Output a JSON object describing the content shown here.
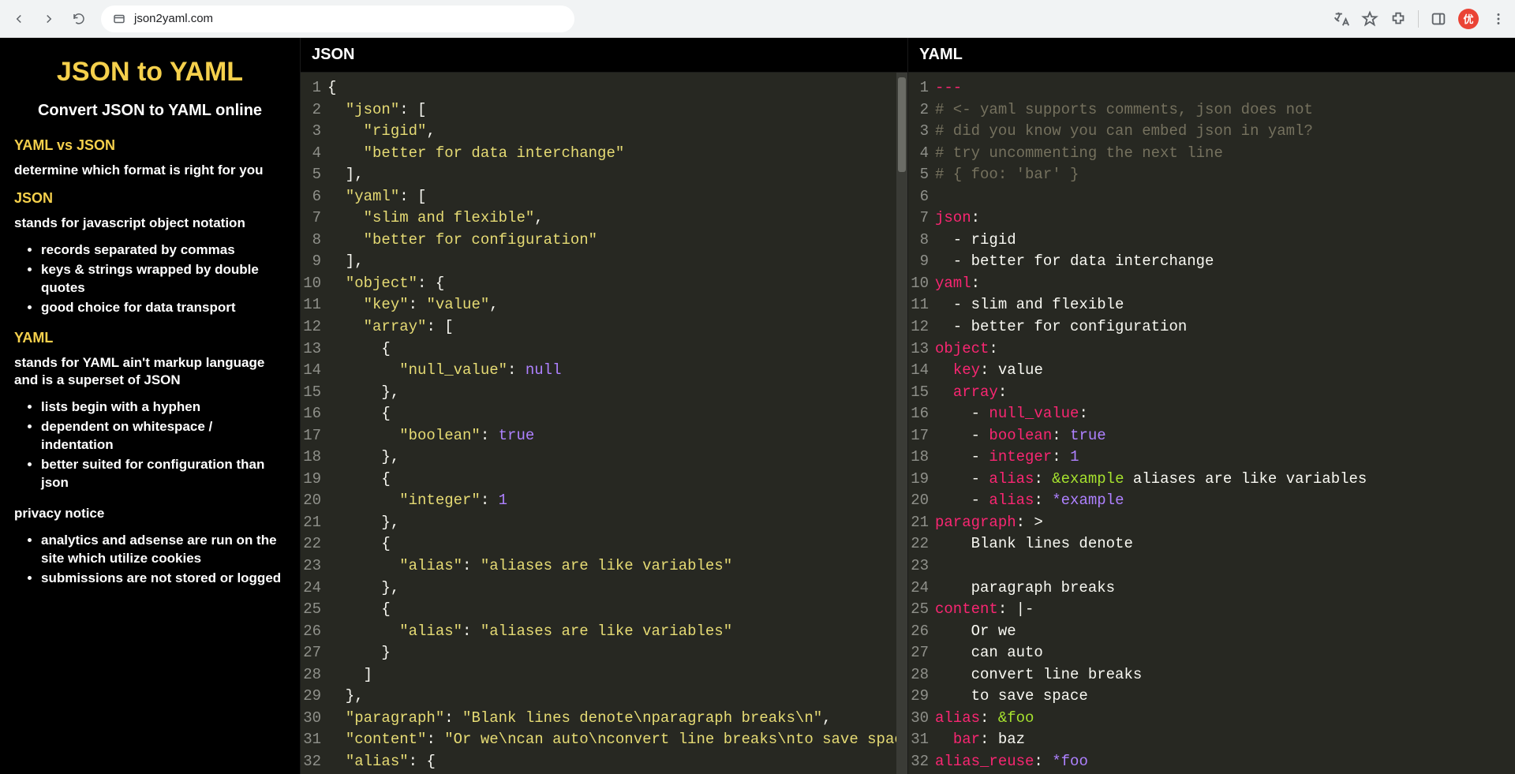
{
  "chrome": {
    "url": "json2yaml.com",
    "avatar_initial": "优"
  },
  "sidebar": {
    "title": "JSON to YAML",
    "subtitle": "Convert JSON to YAML online",
    "sec1_h": "YAML vs JSON",
    "sec1_p": "determine which format is right for you",
    "sec2_h": "JSON",
    "sec2_p": "stands for javascript object notation",
    "sec2_items": [
      "records separated by commas",
      "keys & strings wrapped by double quotes",
      "good choice for data transport"
    ],
    "sec3_h": "YAML",
    "sec3_p": "stands for YAML ain't markup language and is a superset of JSON",
    "sec3_items": [
      "lists begin with a hyphen",
      "dependent on whitespace / indentation",
      "better suited for configuration than json"
    ],
    "sec4_h": "privacy notice",
    "sec4_items": [
      "analytics and adsense are run on the site which utilize cookies",
      "submissions are not stored or logged"
    ]
  },
  "panels": {
    "json_label": "JSON",
    "yaml_label": "YAML"
  },
  "json_lines": [
    [
      {
        "c": "p",
        "t": "{"
      }
    ],
    [
      {
        "c": "p",
        "t": "  "
      },
      {
        "c": "s",
        "t": "\"json\""
      },
      {
        "c": "p",
        "t": ": ["
      }
    ],
    [
      {
        "c": "p",
        "t": "    "
      },
      {
        "c": "s",
        "t": "\"rigid\""
      },
      {
        "c": "p",
        "t": ","
      }
    ],
    [
      {
        "c": "p",
        "t": "    "
      },
      {
        "c": "s",
        "t": "\"better for data interchange\""
      }
    ],
    [
      {
        "c": "p",
        "t": "  ],"
      }
    ],
    [
      {
        "c": "p",
        "t": "  "
      },
      {
        "c": "s",
        "t": "\"yaml\""
      },
      {
        "c": "p",
        "t": ": ["
      }
    ],
    [
      {
        "c": "p",
        "t": "    "
      },
      {
        "c": "s",
        "t": "\"slim and flexible\""
      },
      {
        "c": "p",
        "t": ","
      }
    ],
    [
      {
        "c": "p",
        "t": "    "
      },
      {
        "c": "s",
        "t": "\"better for configuration\""
      }
    ],
    [
      {
        "c": "p",
        "t": "  ],"
      }
    ],
    [
      {
        "c": "p",
        "t": "  "
      },
      {
        "c": "s",
        "t": "\"object\""
      },
      {
        "c": "p",
        "t": ": {"
      }
    ],
    [
      {
        "c": "p",
        "t": "    "
      },
      {
        "c": "s",
        "t": "\"key\""
      },
      {
        "c": "p",
        "t": ": "
      },
      {
        "c": "s",
        "t": "\"value\""
      },
      {
        "c": "p",
        "t": ","
      }
    ],
    [
      {
        "c": "p",
        "t": "    "
      },
      {
        "c": "s",
        "t": "\"array\""
      },
      {
        "c": "p",
        "t": ": ["
      }
    ],
    [
      {
        "c": "p",
        "t": "      {"
      }
    ],
    [
      {
        "c": "p",
        "t": "        "
      },
      {
        "c": "s",
        "t": "\"null_value\""
      },
      {
        "c": "p",
        "t": ": "
      },
      {
        "c": "kw",
        "t": "null"
      }
    ],
    [
      {
        "c": "p",
        "t": "      },"
      }
    ],
    [
      {
        "c": "p",
        "t": "      {"
      }
    ],
    [
      {
        "c": "p",
        "t": "        "
      },
      {
        "c": "s",
        "t": "\"boolean\""
      },
      {
        "c": "p",
        "t": ": "
      },
      {
        "c": "kw",
        "t": "true"
      }
    ],
    [
      {
        "c": "p",
        "t": "      },"
      }
    ],
    [
      {
        "c": "p",
        "t": "      {"
      }
    ],
    [
      {
        "c": "p",
        "t": "        "
      },
      {
        "c": "s",
        "t": "\"integer\""
      },
      {
        "c": "p",
        "t": ": "
      },
      {
        "c": "kw",
        "t": "1"
      }
    ],
    [
      {
        "c": "p",
        "t": "      },"
      }
    ],
    [
      {
        "c": "p",
        "t": "      {"
      }
    ],
    [
      {
        "c": "p",
        "t": "        "
      },
      {
        "c": "s",
        "t": "\"alias\""
      },
      {
        "c": "p",
        "t": ": "
      },
      {
        "c": "s",
        "t": "\"aliases are like variables\""
      }
    ],
    [
      {
        "c": "p",
        "t": "      },"
      }
    ],
    [
      {
        "c": "p",
        "t": "      {"
      }
    ],
    [
      {
        "c": "p",
        "t": "        "
      },
      {
        "c": "s",
        "t": "\"alias\""
      },
      {
        "c": "p",
        "t": ": "
      },
      {
        "c": "s",
        "t": "\"aliases are like variables\""
      }
    ],
    [
      {
        "c": "p",
        "t": "      }"
      }
    ],
    [
      {
        "c": "p",
        "t": "    ]"
      }
    ],
    [
      {
        "c": "p",
        "t": "  },"
      }
    ],
    [
      {
        "c": "p",
        "t": "  "
      },
      {
        "c": "s",
        "t": "\"paragraph\""
      },
      {
        "c": "p",
        "t": ": "
      },
      {
        "c": "s",
        "t": "\"Blank lines denote\\nparagraph breaks\\n\""
      },
      {
        "c": "p",
        "t": ","
      }
    ],
    [
      {
        "c": "p",
        "t": "  "
      },
      {
        "c": "s",
        "t": "\"content\""
      },
      {
        "c": "p",
        "t": ": "
      },
      {
        "c": "s",
        "t": "\"Or we\\ncan auto\\nconvert line breaks\\nto save space\""
      },
      {
        "c": "p",
        "t": ","
      }
    ],
    [
      {
        "c": "p",
        "t": "  "
      },
      {
        "c": "s",
        "t": "\"alias\""
      },
      {
        "c": "p",
        "t": ": {"
      }
    ]
  ],
  "yaml_lines": [
    [
      {
        "c": "k",
        "t": "---"
      }
    ],
    [
      {
        "c": "cm",
        "t": "# <- yaml supports comments, json does not"
      }
    ],
    [
      {
        "c": "cm",
        "t": "# did you know you can embed json in yaml?"
      }
    ],
    [
      {
        "c": "cm",
        "t": "# try uncommenting the next line"
      }
    ],
    [
      {
        "c": "cm",
        "t": "# { foo: 'bar' }"
      }
    ],
    [
      {
        "c": "p",
        "t": ""
      }
    ],
    [
      {
        "c": "k",
        "t": "json"
      },
      {
        "c": "p",
        "t": ":"
      }
    ],
    [
      {
        "c": "p",
        "t": "  - rigid"
      }
    ],
    [
      {
        "c": "p",
        "t": "  - better for data interchange"
      }
    ],
    [
      {
        "c": "k",
        "t": "yaml"
      },
      {
        "c": "p",
        "t": ":"
      }
    ],
    [
      {
        "c": "p",
        "t": "  - slim and flexible"
      }
    ],
    [
      {
        "c": "p",
        "t": "  - better for configuration"
      }
    ],
    [
      {
        "c": "k",
        "t": "object"
      },
      {
        "c": "p",
        "t": ":"
      }
    ],
    [
      {
        "c": "p",
        "t": "  "
      },
      {
        "c": "k",
        "t": "key"
      },
      {
        "c": "p",
        "t": ": value"
      }
    ],
    [
      {
        "c": "p",
        "t": "  "
      },
      {
        "c": "k",
        "t": "array"
      },
      {
        "c": "p",
        "t": ":"
      }
    ],
    [
      {
        "c": "p",
        "t": "    - "
      },
      {
        "c": "k",
        "t": "null_value"
      },
      {
        "c": "p",
        "t": ":"
      }
    ],
    [
      {
        "c": "p",
        "t": "    - "
      },
      {
        "c": "k",
        "t": "boolean"
      },
      {
        "c": "p",
        "t": ": "
      },
      {
        "c": "kw",
        "t": "true"
      }
    ],
    [
      {
        "c": "p",
        "t": "    - "
      },
      {
        "c": "k",
        "t": "integer"
      },
      {
        "c": "p",
        "t": ": "
      },
      {
        "c": "kw",
        "t": "1"
      }
    ],
    [
      {
        "c": "p",
        "t": "    - "
      },
      {
        "c": "k",
        "t": "alias"
      },
      {
        "c": "p",
        "t": ": "
      },
      {
        "c": "id",
        "t": "&example"
      },
      {
        "c": "p",
        "t": " aliases are like variables"
      }
    ],
    [
      {
        "c": "p",
        "t": "    - "
      },
      {
        "c": "k",
        "t": "alias"
      },
      {
        "c": "p",
        "t": ": "
      },
      {
        "c": "kw",
        "t": "*example"
      }
    ],
    [
      {
        "c": "k",
        "t": "paragraph"
      },
      {
        "c": "p",
        "t": ": >"
      }
    ],
    [
      {
        "c": "p",
        "t": "    Blank lines denote"
      }
    ],
    [
      {
        "c": "p",
        "t": ""
      }
    ],
    [
      {
        "c": "p",
        "t": "    paragraph breaks"
      }
    ],
    [
      {
        "c": "k",
        "t": "content"
      },
      {
        "c": "p",
        "t": ": |-"
      }
    ],
    [
      {
        "c": "p",
        "t": "    Or we"
      }
    ],
    [
      {
        "c": "p",
        "t": "    can auto"
      }
    ],
    [
      {
        "c": "p",
        "t": "    convert line breaks"
      }
    ],
    [
      {
        "c": "p",
        "t": "    to save space"
      }
    ],
    [
      {
        "c": "k",
        "t": "alias"
      },
      {
        "c": "p",
        "t": ": "
      },
      {
        "c": "id",
        "t": "&foo"
      }
    ],
    [
      {
        "c": "p",
        "t": "  "
      },
      {
        "c": "k",
        "t": "bar"
      },
      {
        "c": "p",
        "t": ": baz"
      }
    ],
    [
      {
        "c": "k",
        "t": "alias_reuse"
      },
      {
        "c": "p",
        "t": ": "
      },
      {
        "c": "kw",
        "t": "*foo"
      }
    ]
  ]
}
